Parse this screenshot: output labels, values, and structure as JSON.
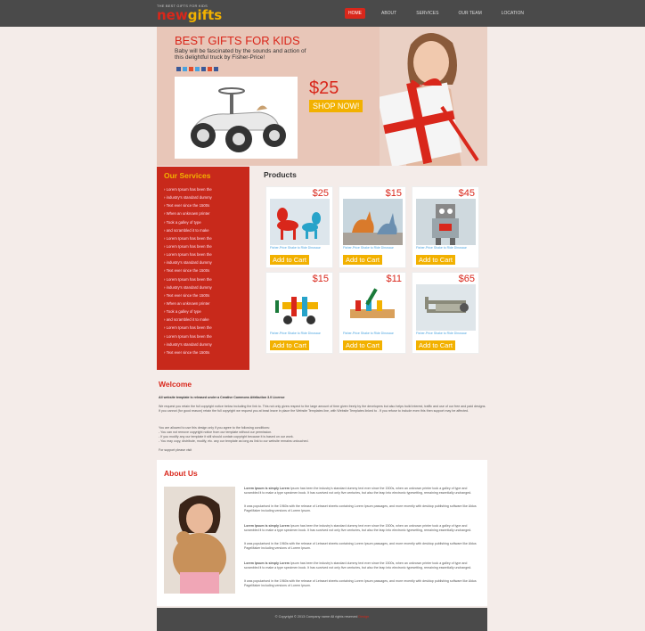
{
  "logo": {
    "small": "THE BEST GIFTS FOR KIDS",
    "new": "new",
    "gifts": "gifts"
  },
  "nav": [
    "HOME",
    "ABOUT",
    "SERVICES",
    "OUR TEAM",
    "LOCATION"
  ],
  "hero": {
    "title": "BEST GIFTS FOR KIDS",
    "subtitle": "Baby will be fascinated by the sounds and action of this delightful truck by Fisher-Price!",
    "price": "$25",
    "cta": "SHOP NOW!"
  },
  "services": {
    "title": "Our Services",
    "items": [
      "Lorem Ipsum has been the",
      "industry's standard dummy",
      "Text ever since the 1500s",
      "When an unknown printer",
      "Took a galley of type",
      "and scrambled it to make",
      "Lorem Ipsum has been the",
      "Lorem Ipsum has been the",
      "Lorem Ipsum has been the",
      "industry's standard dummy",
      "Text ever since the 1500s",
      "Lorem Ipsum has been the",
      "industry's standard dummy",
      "Text ever since the 1500s",
      "When an unknown printer",
      "Took a galley of type",
      "and scrambled it to make",
      "Lorem Ipsum has been the",
      "Lorem Ipsum has been the",
      "industry's standard dummy",
      "Text ever since the 1500s"
    ]
  },
  "products": {
    "title": "Products",
    "items": [
      {
        "price": "$25",
        "desc": "Fisher-Price Shake to Ride Dinosaur",
        "cta": "Add to Cart",
        "icon": "balloon-dog-icon"
      },
      {
        "price": "$15",
        "desc": "Fisher-Price Shake to Ride Dinosaur",
        "cta": "Add to Cart",
        "icon": "dinosaur-icon"
      },
      {
        "price": "$45",
        "desc": "Fisher-Price Shake to Ride Dinosaur",
        "cta": "Add to Cart",
        "icon": "robot-icon"
      },
      {
        "price": "$15",
        "desc": "Fisher-Price Shake to Ride Dinosaur",
        "cta": "Add to Cart",
        "icon": "toy-plane-icon"
      },
      {
        "price": "$11",
        "desc": "Fisher-Price Shake to Ride Dinosaur",
        "cta": "Add to Cart",
        "icon": "pound-bench-icon"
      },
      {
        "price": "$65",
        "desc": "Fisher-Price Shake to Ride Dinosaur",
        "cta": "Add to Cart",
        "icon": "biplane-icon"
      }
    ]
  },
  "welcome": {
    "title": "Welcome",
    "p1": "All website template is released under a Creative Commons Attribution 3.0 License",
    "p2": "We request you retain the full copyright notice below including the link to. This not only gives respect to the large amount of time given freely by the developers but also helps build interest, traffic and use of our free and paid designs. If you cannot (for good reason) retain the full copyright we request you at least leave in place the Website Templates line, with Website Templates linked to . If you refuse to include even this then support may be affected.",
    "p3": "You are allowed to use this design only if you agree to the following conditions:",
    "b1": "- You can not remove copyright notice from our template without our permission.",
    "b2": "- If you modify any our template it still should contain copyright because it is based on our work.",
    "b3": "- You may copy, distribute, modify, etc. any our template as long as link to our website remains untouched.",
    "p4": "For support please visit"
  },
  "about": {
    "title": "About Us",
    "blocks": [
      {
        "lead": "Lorem Ipsum is simply Lorem",
        "text": " Ipsum has been the industry's standard dummy text ever since the 1500s, when an unknown printer took a galley of type and scrambled it to make a type specimen book. It has survived not only five centuries, but also the leap into electronic typesetting, remaining essentially unchanged.",
        "text2": "It was popularised in the 1960s with the release of Letraset sheets containing Lorem Ipsum passages, and more recently with desktop publishing software like Aldus PageMaker including versions of Lorem Ipsum."
      },
      {
        "lead": "Lorem Ipsum is simply Lorem",
        "text": " Ipsum has been the industry's standard dummy text ever since the 1500s, when an unknown printer took a galley of type and scrambled it to make a type specimen book. It has survived not only five centuries, but also the leap into electronic typesetting, remaining essentially unchanged.",
        "text2": "It was popularised in the 1960s with the release of Letraset sheets containing Lorem Ipsum passages, and more recently with desktop publishing software like Aldus PageMaker including versions of Lorem Ipsum."
      },
      {
        "lead": "Lorem Ipsum is simply Lorem",
        "text": " Ipsum has been the industry's standard dummy text ever since the 1500s, when an unknown printer took a galley of type and scrambled it to make a type specimen book. It has survived not only five centuries, but also the leap into electronic typesetting, remaining essentially unchanged.",
        "text2": "It was popularised in the 1960s with the release of Letraset sheets containing Lorem Ipsum passages, and more recently with desktop publishing software like Aldus PageMaker including versions of Lorem Ipsum."
      }
    ]
  },
  "footer": {
    "text": "© Copyright © 2013 Company name All rights reserved",
    "link": "Design"
  },
  "colors": {
    "accent": "#d9271b",
    "yellow": "#f2b100",
    "dark": "#4a4a4a"
  }
}
